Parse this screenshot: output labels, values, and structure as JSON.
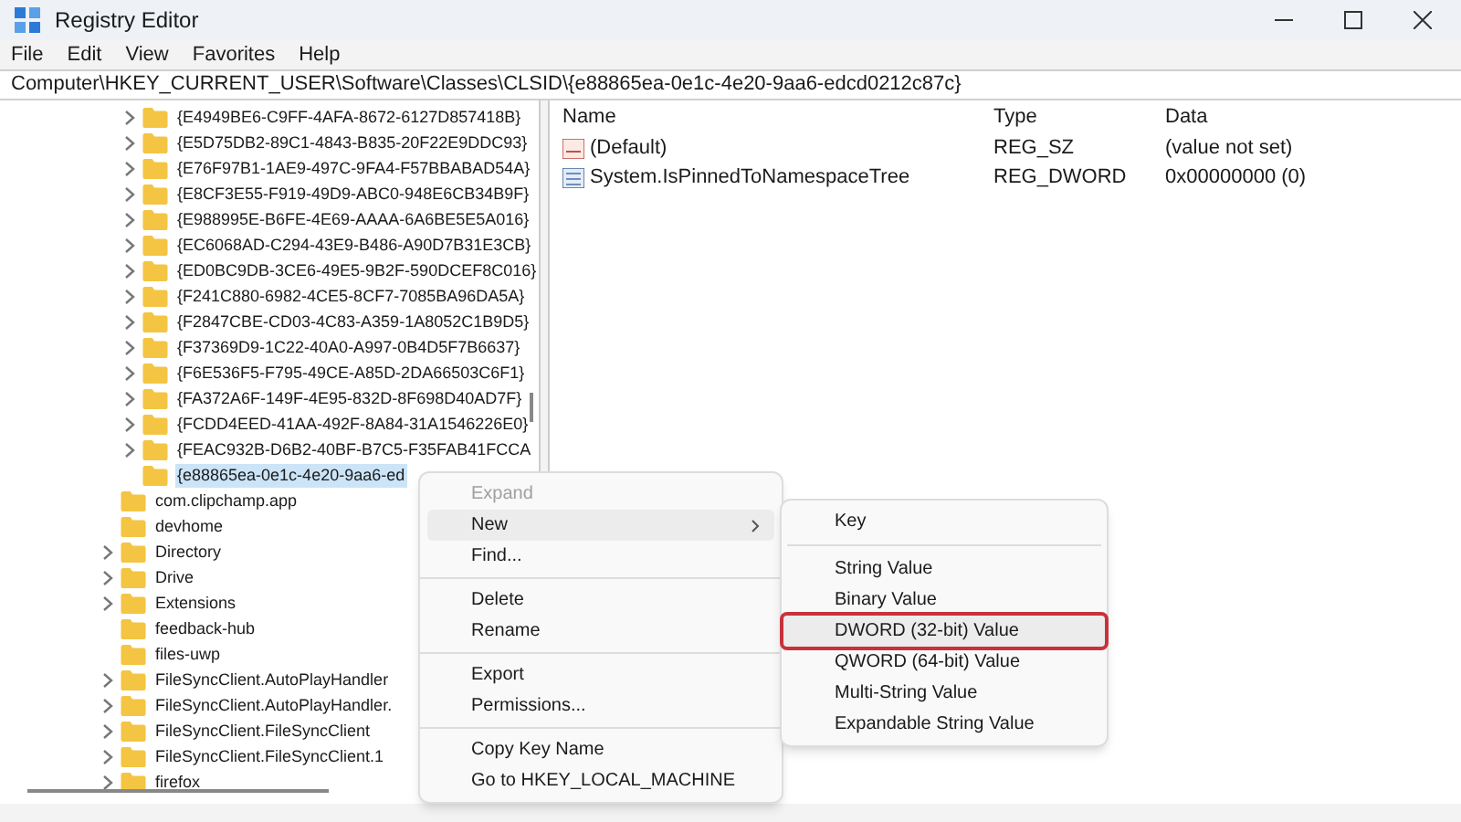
{
  "window": {
    "title": "Registry Editor"
  },
  "menu_bar": [
    "File",
    "Edit",
    "View",
    "Favorites",
    "Help"
  ],
  "address": "Computer\\HKEY_CURRENT_USER\\Software\\Classes\\CLSID\\{e88865ea-0e1c-4e20-9aa6-edcd0212c87c}",
  "tree": {
    "clsid_subkeys": [
      {
        "label": "{E4949BE6-C9FF-4AFA-8672-6127D857418B}",
        "expandable": true,
        "selected": false
      },
      {
        "label": "{E5D75DB2-89C1-4843-B835-20F22E9DDC93}",
        "expandable": true,
        "selected": false
      },
      {
        "label": "{E76F97B1-1AE9-497C-9FA4-F57BBABAD54A}",
        "expandable": true,
        "selected": false
      },
      {
        "label": "{E8CF3E55-F919-49D9-ABC0-948E6CB34B9F}",
        "expandable": true,
        "selected": false
      },
      {
        "label": "{E988995E-B6FE-4E69-AAAA-6A6BE5E5A016}",
        "expandable": true,
        "selected": false
      },
      {
        "label": "{EC6068AD-C294-43E9-B486-A90D7B31E3CB}",
        "expandable": true,
        "selected": false
      },
      {
        "label": "{ED0BC9DB-3CE6-49E5-9B2F-590DCEF8C016}",
        "expandable": true,
        "selected": false
      },
      {
        "label": "{F241C880-6982-4CE5-8CF7-7085BA96DA5A}",
        "expandable": true,
        "selected": false
      },
      {
        "label": "{F2847CBE-CD03-4C83-A359-1A8052C1B9D5}",
        "expandable": true,
        "selected": false
      },
      {
        "label": "{F37369D9-1C22-40A0-A997-0B4D5F7B6637}",
        "expandable": true,
        "selected": false
      },
      {
        "label": "{F6E536F5-F795-49CE-A85D-2DA66503C6F1}",
        "expandable": true,
        "selected": false
      },
      {
        "label": "{FA372A6F-149F-4E95-832D-8F698D40AD7F}",
        "expandable": true,
        "selected": false
      },
      {
        "label": "{FCDD4EED-41AA-492F-8A84-31A1546226E0}",
        "expandable": true,
        "selected": false
      },
      {
        "label": "{FEAC932B-D6B2-40BF-B7C5-F35FAB41FCCA",
        "expandable": true,
        "selected": false
      },
      {
        "label": "{e88865ea-0e1c-4e20-9aa6-ed",
        "expandable": false,
        "selected": true
      }
    ],
    "classes_subkeys": [
      {
        "label": "com.clipchamp.app",
        "expandable": false,
        "selected": false
      },
      {
        "label": "devhome",
        "expandable": false,
        "selected": false
      },
      {
        "label": "Directory",
        "expandable": true,
        "selected": false
      },
      {
        "label": "Drive",
        "expandable": true,
        "selected": false
      },
      {
        "label": "Extensions",
        "expandable": true,
        "selected": false
      },
      {
        "label": "feedback-hub",
        "expandable": false,
        "selected": false
      },
      {
        "label": "files-uwp",
        "expandable": false,
        "selected": false
      },
      {
        "label": "FileSyncClient.AutoPlayHandler",
        "expandable": true,
        "selected": false
      },
      {
        "label": "FileSyncClient.AutoPlayHandler.",
        "expandable": true,
        "selected": false
      },
      {
        "label": "FileSyncClient.FileSyncClient",
        "expandable": true,
        "selected": false
      },
      {
        "label": "FileSyncClient.FileSyncClient.1",
        "expandable": true,
        "selected": false
      },
      {
        "label": "firefox",
        "expandable": true,
        "selected": false
      }
    ]
  },
  "values_table": {
    "columns": [
      "Name",
      "Type",
      "Data"
    ],
    "rows": [
      {
        "kind": "string",
        "name": "(Default)",
        "type": "REG_SZ",
        "data": "(value not set)"
      },
      {
        "kind": "binary",
        "name": "System.IsPinnedToNamespaceTree",
        "type": "REG_DWORD",
        "data": "0x00000000 (0)"
      }
    ]
  },
  "context_menu": [
    {
      "kind": "item",
      "label": "Expand",
      "disabled": true,
      "selected": false,
      "submenu": false
    },
    {
      "kind": "item",
      "label": "New",
      "disabled": false,
      "selected": true,
      "submenu": true
    },
    {
      "kind": "item",
      "label": "Find...",
      "disabled": false,
      "selected": false,
      "submenu": false
    },
    {
      "kind": "separator"
    },
    {
      "kind": "item",
      "label": "Delete",
      "disabled": false,
      "selected": false,
      "submenu": false
    },
    {
      "kind": "item",
      "label": "Rename",
      "disabled": false,
      "selected": false,
      "submenu": false
    },
    {
      "kind": "separator"
    },
    {
      "kind": "item",
      "label": "Export",
      "disabled": false,
      "selected": false,
      "submenu": false
    },
    {
      "kind": "item",
      "label": "Permissions...",
      "disabled": false,
      "selected": false,
      "submenu": false
    },
    {
      "kind": "separator"
    },
    {
      "kind": "item",
      "label": "Copy Key Name",
      "disabled": false,
      "selected": false,
      "submenu": false
    },
    {
      "kind": "item",
      "label": "Go to HKEY_LOCAL_MACHINE",
      "disabled": false,
      "selected": false,
      "submenu": false
    }
  ],
  "submenu": [
    {
      "kind": "item",
      "label": "Key",
      "selected": false
    },
    {
      "kind": "separator"
    },
    {
      "kind": "item",
      "label": "String Value",
      "selected": false
    },
    {
      "kind": "item",
      "label": "Binary Value",
      "selected": false
    },
    {
      "kind": "item",
      "label": "DWORD (32-bit) Value",
      "selected": true
    },
    {
      "kind": "item",
      "label": "QWORD (64-bit) Value",
      "selected": false
    },
    {
      "kind": "item",
      "label": "Multi-String Value",
      "selected": false
    },
    {
      "kind": "item",
      "label": "Expandable String Value",
      "selected": false
    }
  ]
}
